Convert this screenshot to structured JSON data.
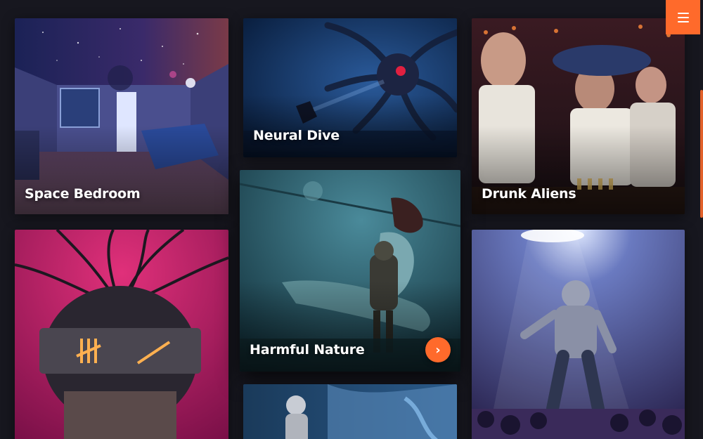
{
  "gallery": {
    "cards": [
      {
        "title": "Space Bedroom"
      },
      {
        "title": "Neural Dive"
      },
      {
        "title": "Drunk Aliens"
      },
      {
        "title": ""
      },
      {
        "title": "Harmful Nature"
      },
      {
        "title": ""
      },
      {
        "title": ""
      }
    ]
  },
  "buttons": {
    "menu_icon": "hamburger-icon",
    "next_icon": "chevron-right-icon",
    "next_glyph": "›"
  },
  "colors": {
    "background": "#17171f",
    "accent": "#ff6a2b",
    "title": "#ffffff"
  }
}
